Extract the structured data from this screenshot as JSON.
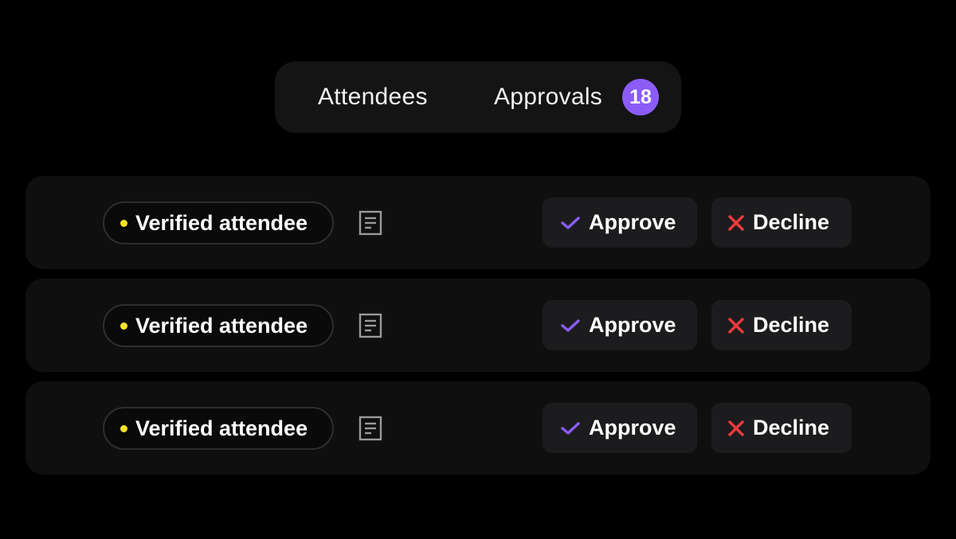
{
  "colors": {
    "background": "#000000",
    "accent_purple": "#8b5cf6",
    "verified_dot": "#f5e32a",
    "decline_red": "#ef3b3b"
  },
  "tabs": {
    "attendees_label": "Attendees",
    "approvals_label": "Approvals",
    "approvals_count": "18"
  },
  "rows": [
    {
      "status": "Verified attendee",
      "approve_label": "Approve",
      "decline_label": "Decline"
    },
    {
      "status": "Verified attendee",
      "approve_label": "Approve",
      "decline_label": "Decline"
    },
    {
      "status": "Verified attendee",
      "approve_label": "Approve",
      "decline_label": "Decline"
    }
  ],
  "icons": {
    "document": "document-icon",
    "approve": "check-icon",
    "decline": "close-icon"
  }
}
